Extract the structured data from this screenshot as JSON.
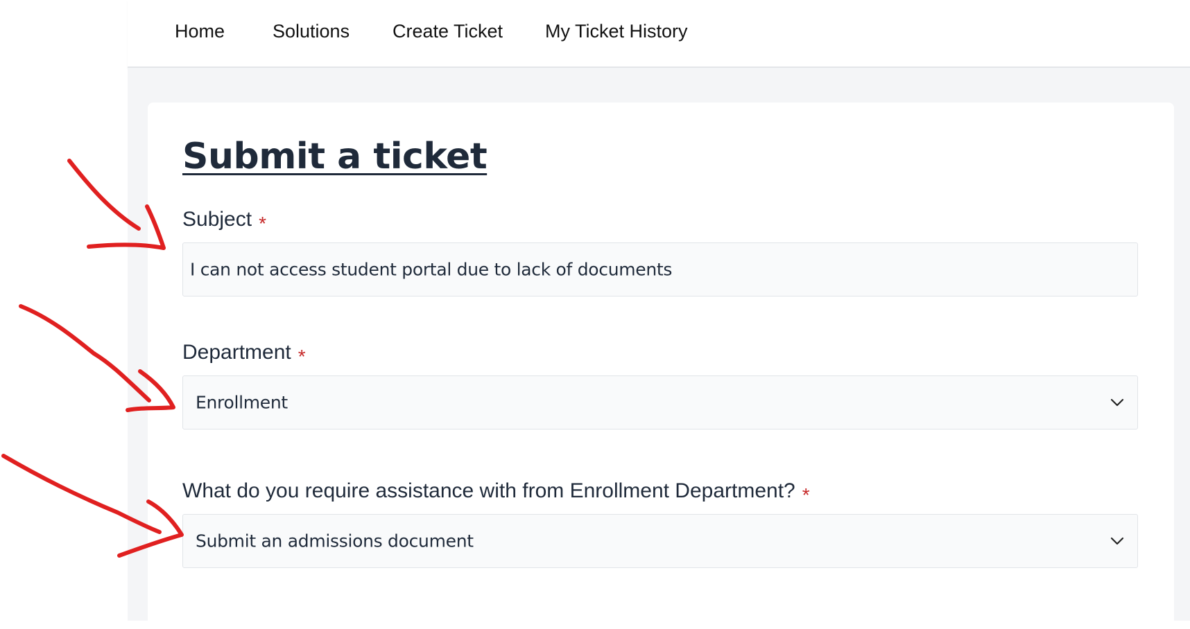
{
  "nav": {
    "items": [
      {
        "label": "Home"
      },
      {
        "label": "Solutions"
      },
      {
        "label": "Create Ticket"
      },
      {
        "label": "My Ticket History"
      }
    ]
  },
  "page": {
    "title": "Submit a ticket"
  },
  "form": {
    "required_marker": "*",
    "subject": {
      "label": "Subject",
      "value": "I can not access student portal due to lack of documents"
    },
    "department": {
      "label": "Department",
      "selected": "Enrollment"
    },
    "assistance": {
      "label": "What do you require assistance with from Enrollment Department?",
      "selected": "Submit an admissions document"
    }
  },
  "colors": {
    "required": "#c62828",
    "annotation": "#e02020",
    "panel_bg": "#f4f5f7"
  },
  "icons": {
    "select_arrow": "chevron-down-icon"
  }
}
